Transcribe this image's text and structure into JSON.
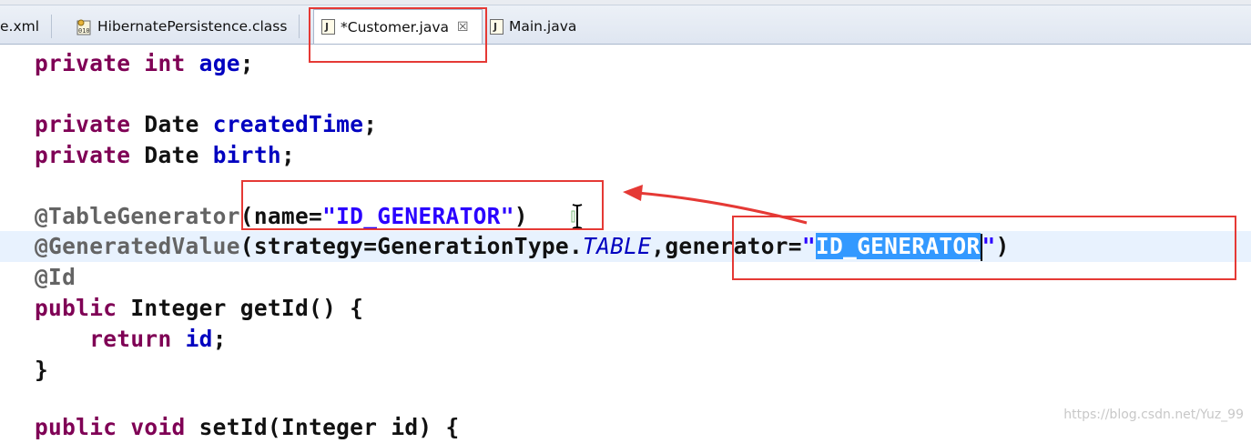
{
  "tabs": [
    {
      "label": "e.xml",
      "icon": "xml-file-icon"
    },
    {
      "label": "HibernatePersistence.class",
      "icon": "class-file-icon"
    },
    {
      "label": "*Customer.java",
      "icon": "java-file-icon",
      "active": true
    },
    {
      "label": "Main.java",
      "icon": "java-file-icon"
    }
  ],
  "editor": {
    "lines": {
      "l1": {
        "kw1": "private",
        "kw2": "int",
        "name": "age",
        "end": ";"
      },
      "l2": {
        "kw": "private",
        "type": "Date",
        "name": "createdTime",
        "end": ";"
      },
      "l3": {
        "kw": "private",
        "type": "Date",
        "name": "birth",
        "end": ";"
      },
      "l4": {
        "ann": "@TableGenerator",
        "open": "(name=",
        "str": "\"ID_GENERATOR\"",
        "close": ")"
      },
      "l5": {
        "ann": "@GeneratedValue",
        "open": "(strategy=GenerationType.",
        "const": "TABLE",
        "mid": ",generator=",
        "q1": "\"",
        "sel": "ID_GENERATOR",
        "q2": "\"",
        "close": ")"
      },
      "l6": {
        "ann": "@Id"
      },
      "l7": {
        "kw": "public",
        "rest": " Integer getId() {"
      },
      "l8": {
        "kw": "return",
        "name": "id",
        "end": ";"
      },
      "l9": {
        "text": "}"
      },
      "l10": {
        "kw1": "public",
        "kw2": "void",
        "rest": " setId(Integer id) {"
      }
    }
  },
  "watermark": "https://blog.csdn.net/Yuz_99",
  "colors": {
    "annotation_box": "#e53935",
    "selection": "#3399ff",
    "current_line": "#e8f2fe"
  }
}
